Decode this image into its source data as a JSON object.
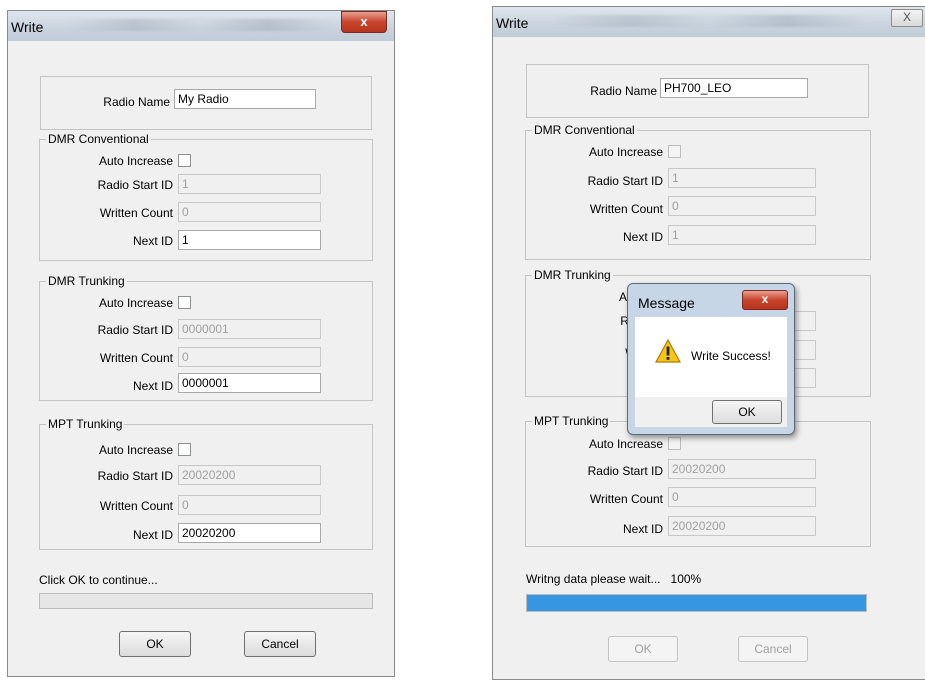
{
  "left_dialog": {
    "title": "Write",
    "close_glyph": "x",
    "radio_name_label": "Radio Name",
    "radio_name_value": "My Radio",
    "dmr_conventional": {
      "group_label": "DMR Conventional",
      "auto_increase_label": "Auto Increase",
      "start_id_label": "Radio Start ID",
      "start_id_value": "1",
      "written_count_label": "Written Count",
      "written_count_value": "0",
      "next_id_label": "Next ID",
      "next_id_value": "1"
    },
    "dmr_trunking": {
      "group_label": "DMR Trunking",
      "auto_increase_label": "Auto Increase",
      "start_id_label": "Radio Start ID",
      "start_id_value": "0000001",
      "written_count_label": "Written Count",
      "written_count_value": "0",
      "next_id_label": "Next ID",
      "next_id_value": "0000001"
    },
    "mpt_trunking": {
      "group_label": "MPT Trunking",
      "auto_increase_label": "Auto Increase",
      "start_id_label": "Radio Start ID",
      "start_id_value": "20020200",
      "written_count_label": "Written Count",
      "written_count_value": "0",
      "next_id_label": "Next ID",
      "next_id_value": "20020200"
    },
    "status_text": "Click OK to continue...",
    "progress": 0,
    "ok_label": "OK",
    "cancel_label": "Cancel"
  },
  "right_dialog": {
    "title": "Write",
    "close_glyph": "X",
    "radio_name_label": "Radio Name",
    "radio_name_value": "PH700_LEO",
    "dmr_conventional": {
      "group_label": "DMR Conventional",
      "auto_increase_label": "Auto Increase",
      "start_id_label": "Radio Start ID",
      "start_id_value": "1",
      "written_count_label": "Written Count",
      "written_count_value": "0",
      "next_id_label": "Next ID",
      "next_id_value": "1"
    },
    "dmr_trunking": {
      "group_label": "DMR Trunking",
      "auto_increase_label": "Auto Inc",
      "start_id_label": "Radio S",
      "written_count_label": "Written",
      "next_id_label": "N"
    },
    "mpt_trunking": {
      "group_label": "MPT Trunking",
      "auto_increase_label": "Auto Increase",
      "start_id_label": "Radio Start ID",
      "start_id_value": "20020200",
      "written_count_label": "Written Count",
      "written_count_value": "0",
      "next_id_label": "Next ID",
      "next_id_value": "20020200"
    },
    "status_text": "Writng data please wait...",
    "progress_text": "100%",
    "progress": 1.0,
    "ok_label": "OK",
    "cancel_label": "Cancel"
  },
  "message_box": {
    "title": "Message",
    "close_glyph": "x",
    "icon": "warning-icon",
    "text": "Write Success!",
    "ok_label": "OK"
  },
  "colors": {
    "progress_fill": "#3696e2",
    "dialog_bg": "#f0f0f0",
    "close_red": "#c8442c"
  }
}
